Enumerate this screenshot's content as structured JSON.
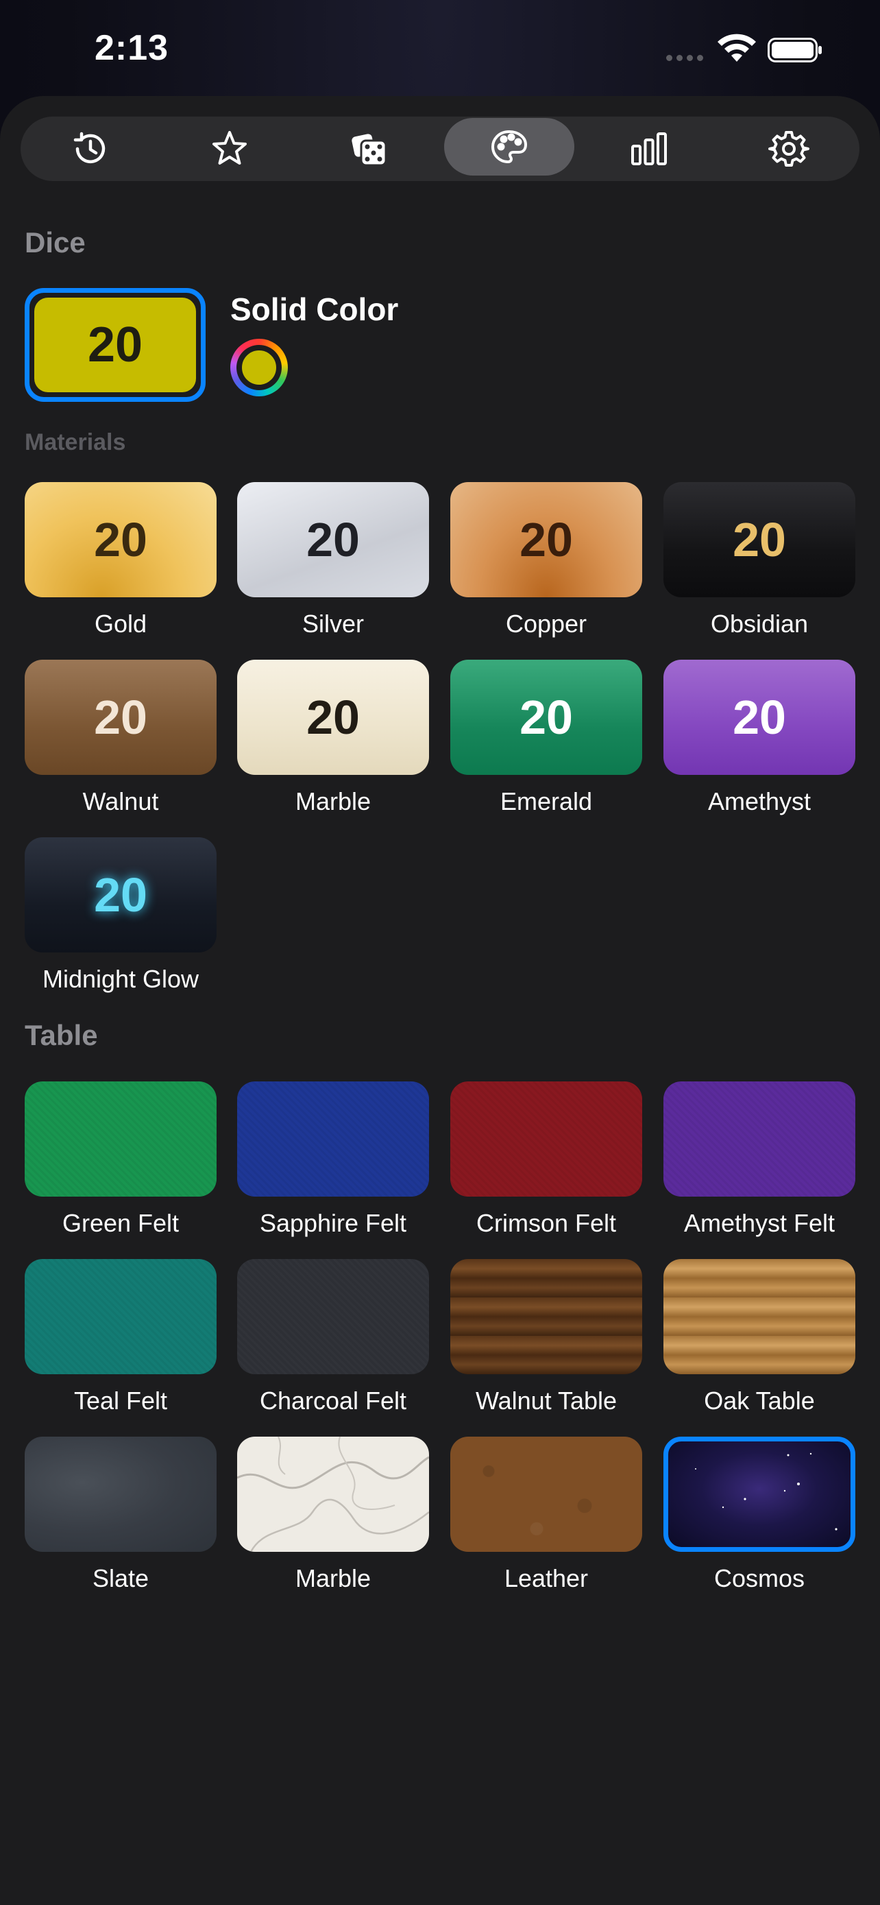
{
  "status": {
    "time": "2:13"
  },
  "tabs": [
    {
      "name": "history"
    },
    {
      "name": "favorites"
    },
    {
      "name": "dice"
    },
    {
      "name": "appearance",
      "active": true
    },
    {
      "name": "stats"
    },
    {
      "name": "settings"
    }
  ],
  "dice_section": {
    "title": "Dice",
    "solid": {
      "number": "20",
      "label": "Solid Color",
      "color": "#c6bc00"
    },
    "materials_title": "Materials",
    "materials": [
      {
        "label": "Gold",
        "number": "20"
      },
      {
        "label": "Silver",
        "number": "20"
      },
      {
        "label": "Copper",
        "number": "20"
      },
      {
        "label": "Obsidian",
        "number": "20"
      },
      {
        "label": "Walnut",
        "number": "20"
      },
      {
        "label": "Marble",
        "number": "20"
      },
      {
        "label": "Emerald",
        "number": "20"
      },
      {
        "label": "Amethyst",
        "number": "20"
      },
      {
        "label": "Midnight Glow",
        "number": "20"
      }
    ]
  },
  "table_section": {
    "title": "Table",
    "items": [
      {
        "label": "Green Felt"
      },
      {
        "label": "Sapphire Felt"
      },
      {
        "label": "Crimson Felt"
      },
      {
        "label": "Amethyst Felt"
      },
      {
        "label": "Teal Felt"
      },
      {
        "label": "Charcoal Felt"
      },
      {
        "label": "Walnut Table"
      },
      {
        "label": "Oak Table"
      },
      {
        "label": "Slate"
      },
      {
        "label": "Marble"
      },
      {
        "label": "Leather"
      },
      {
        "label": "Cosmos",
        "selected": true
      }
    ]
  },
  "colors": {
    "accent": "#0a84ff",
    "sheet": "#1c1c1e"
  }
}
